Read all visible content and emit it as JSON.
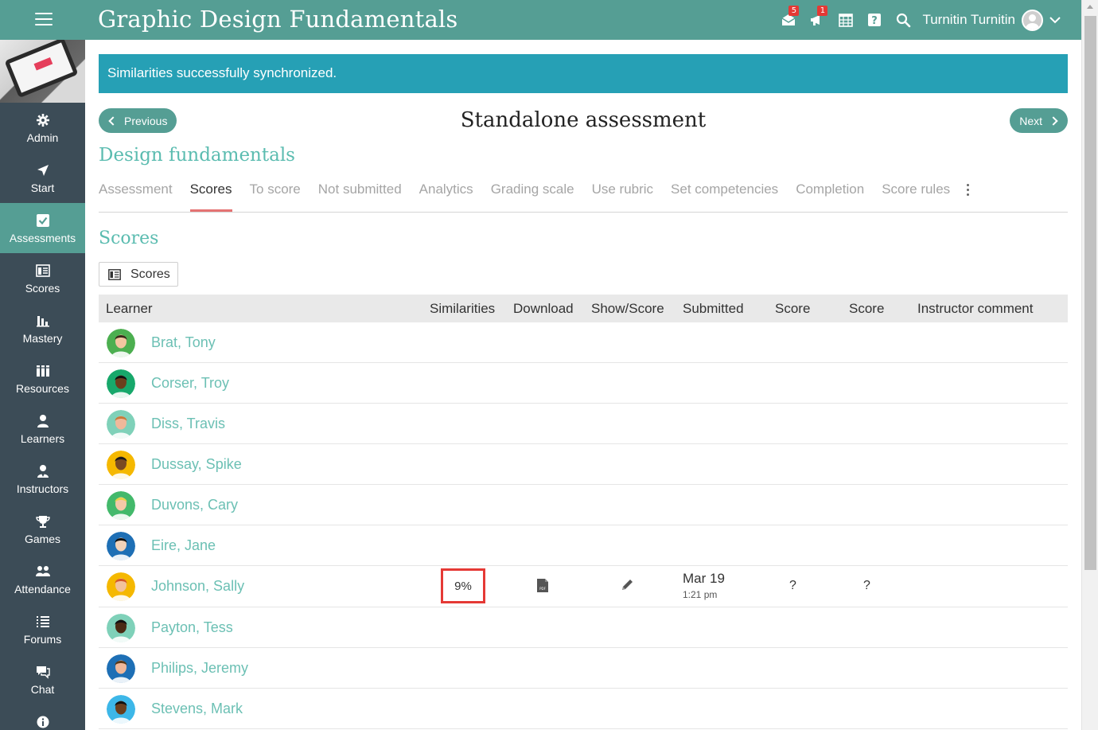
{
  "header": {
    "title": "Graphic Design Fundamentals",
    "messages_badge": "5",
    "notifications_badge": "1",
    "user_name": "Turnitin Turnitin"
  },
  "sidebar": {
    "items": [
      {
        "label": "Admin",
        "icon": "gear-icon"
      },
      {
        "label": "Start",
        "icon": "send-icon"
      },
      {
        "label": "Assessments",
        "icon": "checkbox-icon",
        "active": true
      },
      {
        "label": "Scores",
        "icon": "gradebook-icon"
      },
      {
        "label": "Mastery",
        "icon": "bar-chart-icon"
      },
      {
        "label": "Resources",
        "icon": "books-icon"
      },
      {
        "label": "Learners",
        "icon": "person-icon"
      },
      {
        "label": "Instructors",
        "icon": "instructor-icon"
      },
      {
        "label": "Games",
        "icon": "trophy-icon"
      },
      {
        "label": "Attendance",
        "icon": "group-icon"
      },
      {
        "label": "Forums",
        "icon": "list-icon"
      },
      {
        "label": "Chat",
        "icon": "chat-icon"
      }
    ]
  },
  "alert": {
    "message": "Similarities successfully synchronized."
  },
  "nav": {
    "previous": "Previous",
    "next": "Next"
  },
  "page": {
    "title": "Standalone assessment",
    "section": "Design fundamentals"
  },
  "tabs": [
    "Assessment",
    "Scores",
    "To score",
    "Not submitted",
    "Analytics",
    "Grading scale",
    "Use rubric",
    "Set competencies",
    "Completion",
    "Score rules"
  ],
  "active_tab": "Scores",
  "scores": {
    "heading": "Scores",
    "button_label": "Scores"
  },
  "table": {
    "columns": [
      "Learner",
      "Similarities",
      "Download",
      "Show/Score",
      "Submitted",
      "Score",
      "Score",
      "Instructor comment"
    ],
    "rows": [
      {
        "name": "Brat, Tony",
        "avatar_bg": "#4caf50",
        "skin": "#f2c6a0",
        "hair": "#3a2a1a"
      },
      {
        "name": "Corser, Troy",
        "avatar_bg": "#17a86b",
        "skin": "#6b3f1d",
        "hair": "#111111"
      },
      {
        "name": "Diss, Travis",
        "avatar_bg": "#7fd1b9",
        "skin": "#f0b89a",
        "hair": "#c87a3a"
      },
      {
        "name": "Dussay, Spike",
        "avatar_bg": "#f5b800",
        "skin": "#7a4a22",
        "hair": "#1a1a1a"
      },
      {
        "name": "Duvons, Cary",
        "avatar_bg": "#43b96b",
        "skin": "#f4c9a8",
        "hair": "#e8d24a"
      },
      {
        "name": "Eire, Jane",
        "avatar_bg": "#1e6fb5",
        "skin": "#f3d2b8",
        "hair": "#111111"
      },
      {
        "name": "Johnson, Sally",
        "avatar_bg": "#f5b800",
        "skin": "#f2c29c",
        "hair": "#d4572a",
        "similarity": "9%",
        "submitted_date": "Mar 19",
        "submitted_time": "1:21 pm",
        "score1": "?",
        "score2": "?"
      },
      {
        "name": "Payton, Tess",
        "avatar_bg": "#7fd1b9",
        "skin": "#4a2a14",
        "hair": "#111111"
      },
      {
        "name": "Philips, Jeremy",
        "avatar_bg": "#1e6fb5",
        "skin": "#f0b89a",
        "hair": "#5a3a1a"
      },
      {
        "name": "Stevens, Mark",
        "avatar_bg": "#3db7e8",
        "skin": "#6b3f1d",
        "hair": "#111111"
      }
    ]
  }
}
